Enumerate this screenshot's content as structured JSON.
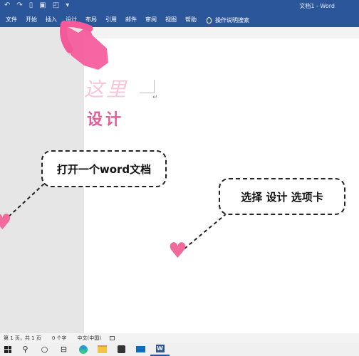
{
  "window": {
    "title": "文档1 - Word"
  },
  "quick_access": [
    "undo-icon",
    "redo-icon",
    "new-doc-icon",
    "save-icon",
    "print-preview-icon",
    "customize-icon"
  ],
  "ribbon": {
    "tabs": [
      {
        "label": "文件"
      },
      {
        "label": "开始"
      },
      {
        "label": "插入"
      },
      {
        "label": "设计"
      },
      {
        "label": "布局"
      },
      {
        "label": "引用"
      },
      {
        "label": "邮件"
      },
      {
        "label": "审阅"
      },
      {
        "label": "视图"
      },
      {
        "label": "帮助"
      }
    ],
    "tell_me": "操作说明搜索"
  },
  "annotations": {
    "ghost_text": "这里",
    "design_label": "设计",
    "bubble_open_doc": "打开一个word文档",
    "bubble_select_tab": "选择 设计 选项卡",
    "accent_color": "#e85b97"
  },
  "statusbar": {
    "page": "第 1 页，共 1 页",
    "words": "0 个字",
    "language": "中文(中国)"
  },
  "taskbar": [
    "windows-start",
    "search-icon",
    "cortana-icon",
    "task-view-icon",
    "edge-icon",
    "file-explorer-icon",
    "store-icon",
    "mail-icon",
    "word-icon"
  ]
}
